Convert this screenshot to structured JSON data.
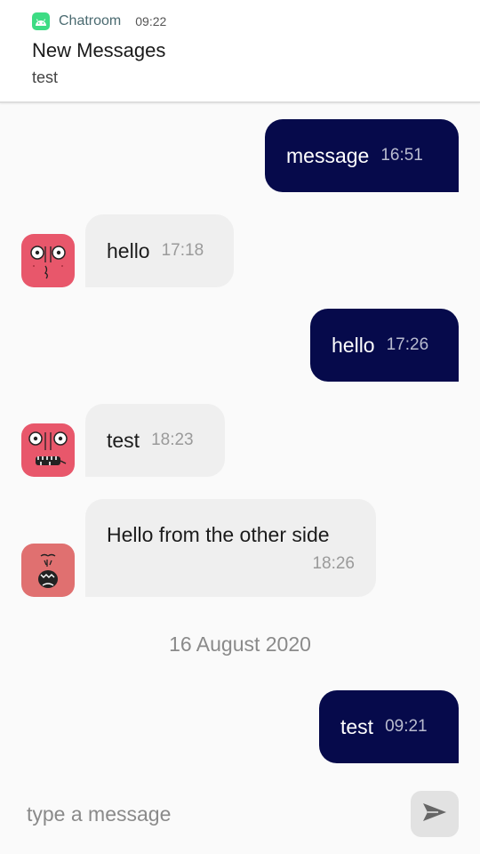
{
  "notification": {
    "app_name": "Chatroom",
    "time": "09:22",
    "title": "New Messages",
    "text": "test"
  },
  "messages": [
    {
      "direction": "out",
      "text": "message",
      "time": "16:51"
    },
    {
      "direction": "in",
      "text": "hello",
      "time": "17:18"
    },
    {
      "direction": "out",
      "text": "hello",
      "time": "17:26"
    },
    {
      "direction": "in",
      "text": "test",
      "time": "18:23"
    },
    {
      "direction": "in",
      "text": "Hello from the other side",
      "time": "18:26"
    },
    {
      "direction": "out",
      "text": "test",
      "time": "09:21"
    }
  ],
  "date_separator": "16 August 2020",
  "composer": {
    "placeholder": "type a message",
    "send_icon": "send-icon"
  },
  "colors": {
    "outgoing_bubble": "#060a4b",
    "incoming_bubble": "#efefef",
    "avatar": "#e8576b"
  }
}
